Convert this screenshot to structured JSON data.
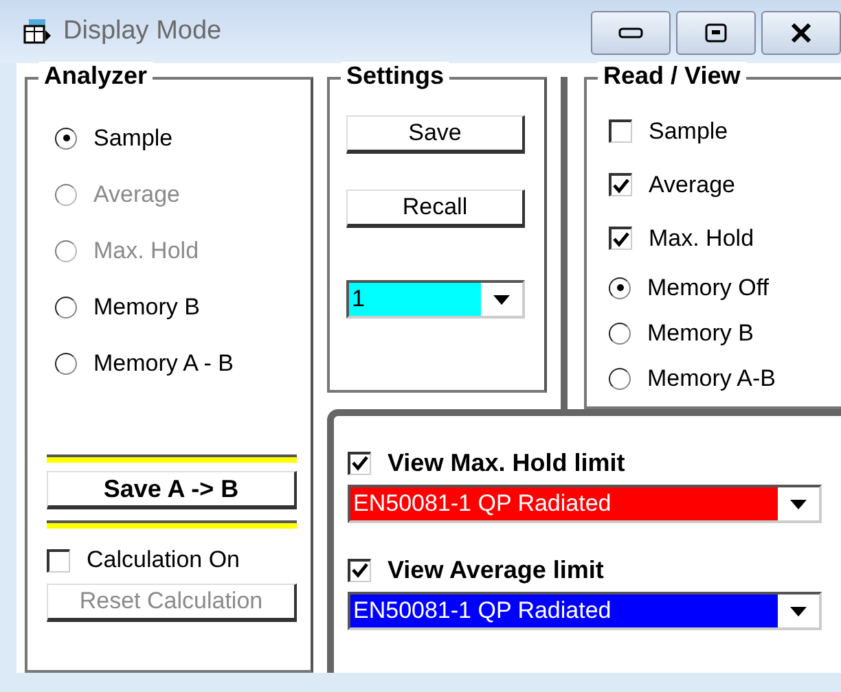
{
  "window": {
    "title": "Display Mode"
  },
  "analyzer": {
    "title": "Analyzer",
    "options": [
      {
        "label": "Sample",
        "selected": true,
        "disabled": false
      },
      {
        "label": "Average",
        "selected": false,
        "disabled": true
      },
      {
        "label": "Max. Hold",
        "selected": false,
        "disabled": true
      },
      {
        "label": "Memory B",
        "selected": false,
        "disabled": false
      },
      {
        "label": "Memory A - B",
        "selected": false,
        "disabled": false
      }
    ],
    "save_button": "Save A -> B",
    "calculation": {
      "label": "Calculation On",
      "checked": false
    },
    "reset_button": {
      "label": "Reset Calculation",
      "disabled": true
    }
  },
  "settings": {
    "title": "Settings",
    "buttons": [
      "Save",
      "Recall"
    ],
    "slot": {
      "value": "1",
      "color": "#00ffff"
    }
  },
  "read_view": {
    "title": "Read / View",
    "items": [
      {
        "kind": "checkbox",
        "label": "Sample",
        "checked": false
      },
      {
        "kind": "checkbox",
        "label": "Average",
        "checked": true
      },
      {
        "kind": "checkbox",
        "label": "Max. Hold",
        "checked": true
      },
      {
        "kind": "radio",
        "label": "Memory Off",
        "selected": true
      },
      {
        "kind": "radio",
        "label": "Memory B",
        "selected": false
      },
      {
        "kind": "radio",
        "label": "Memory A-B",
        "selected": false
      }
    ]
  },
  "limits": [
    {
      "label": "View Max. Hold limit",
      "checked": true,
      "value": "EN50081-1 QP Radiated",
      "color": "#ff0000"
    },
    {
      "label": "View Average limit",
      "checked": true,
      "value": "EN50081-1 QP Radiated",
      "color": "#0000ff"
    }
  ]
}
